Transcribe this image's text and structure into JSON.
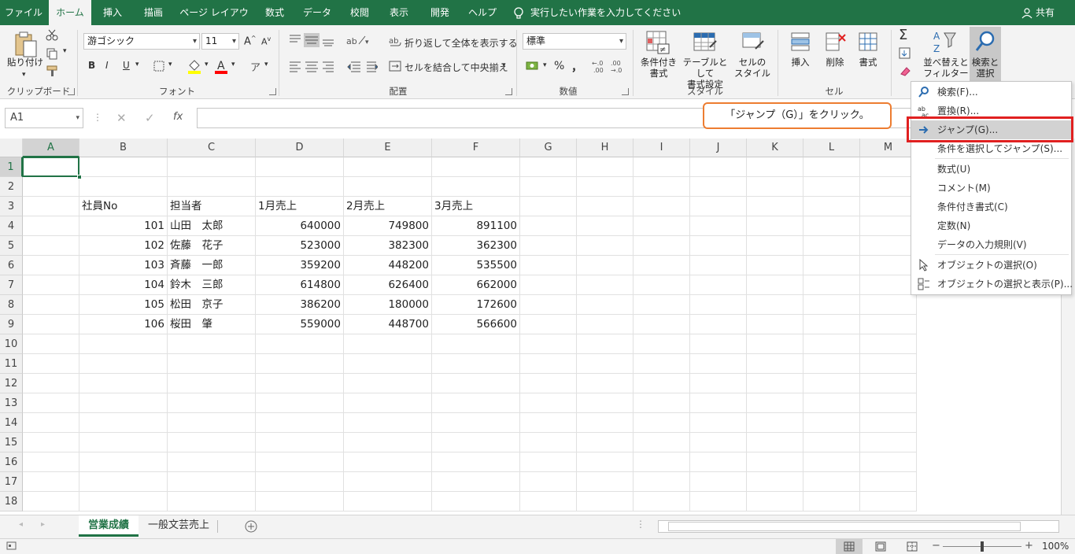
{
  "colors": {
    "excel_green": "#217346",
    "callout_border": "#ed7d31",
    "highlight_red": "#e02020"
  },
  "menu": {
    "file": "ファイル",
    "home": "ホーム",
    "insert": "挿入",
    "draw": "描画",
    "page_layout": "ページ レイアウト",
    "formulas": "数式",
    "data": "データ",
    "review": "校閲",
    "view": "表示",
    "developer": "開発",
    "help": "ヘルプ",
    "tell_me": "実行したい作業を入力してください",
    "share": "共有"
  },
  "ribbon": {
    "clipboard": {
      "paste": "貼り付け",
      "label": "クリップボード"
    },
    "font": {
      "name": "游ゴシック",
      "size": "11",
      "bold": "B",
      "italic": "I",
      "underline": "U",
      "label": "フォント"
    },
    "alignment": {
      "wrap_text": "折り返して全体を表示する",
      "merge_center": "セルを結合して中央揃え",
      "label": "配置"
    },
    "number": {
      "format": "標準",
      "percent": "%",
      "comma": "，",
      "label": "数値"
    },
    "styles": {
      "conditional": "条件付き\n書式",
      "table": "テーブルとして\n書式設定",
      "cell_styles": "セルの\nスタイル",
      "label": "スタイル"
    },
    "cells": {
      "insert": "挿入",
      "delete": "削除",
      "format": "書式",
      "label": "セル"
    },
    "editing": {
      "sort_filter": "並べ替えと\nフィルター",
      "find_select": "検索と\n選択"
    }
  },
  "formula_bar": {
    "name_box": "A1",
    "fx": "fx"
  },
  "columns": [
    "A",
    "B",
    "C",
    "D",
    "E",
    "F",
    "G",
    "H",
    "I",
    "J",
    "K",
    "L",
    "M"
  ],
  "rows": [
    "1",
    "2",
    "3",
    "4",
    "5",
    "6",
    "7",
    "8",
    "9",
    "10",
    "11",
    "12",
    "13",
    "14",
    "15",
    "16",
    "17",
    "18"
  ],
  "sheet": {
    "headers": [
      "社員No",
      "担当者",
      "1月売上",
      "2月売上",
      "3月売上"
    ],
    "data": [
      [
        "101",
        "山田　太郎",
        "640000",
        "749800",
        "891100"
      ],
      [
        "102",
        "佐藤　花子",
        "523000",
        "382300",
        "362300"
      ],
      [
        "103",
        "斉藤　一郎",
        "359200",
        "448200",
        "535500"
      ],
      [
        "104",
        "鈴木　三郎",
        "614800",
        "626400",
        "662000"
      ],
      [
        "105",
        "松田　京子",
        "386200",
        "180000",
        "172600"
      ],
      [
        "106",
        "桜田　肇",
        "559000",
        "448700",
        "566600"
      ]
    ]
  },
  "sheet_tabs": [
    "営業成績",
    "一般文芸売上"
  ],
  "callout": "「ジャンプ（G）」をクリック。",
  "dropdown": [
    {
      "label": "検索(F)...",
      "icon": "search-icon"
    },
    {
      "label": "置換(R)...",
      "icon": "replace-icon"
    },
    {
      "label": "ジャンプ(G)...",
      "icon": "arrow-right-icon"
    },
    {
      "label": "条件を選択してジャンプ(S)...",
      "icon": ""
    },
    {
      "label": "数式(U)",
      "icon": ""
    },
    {
      "label": "コメント(M)",
      "icon": ""
    },
    {
      "label": "条件付き書式(C)",
      "icon": ""
    },
    {
      "label": "定数(N)",
      "icon": ""
    },
    {
      "label": "データの入力規則(V)",
      "icon": ""
    },
    {
      "label": "オブジェクトの選択(O)",
      "icon": "cursor-icon"
    },
    {
      "label": "オブジェクトの選択と表示(P)...",
      "icon": "selection-pane-icon"
    }
  ],
  "status": {
    "zoom": "100%"
  }
}
